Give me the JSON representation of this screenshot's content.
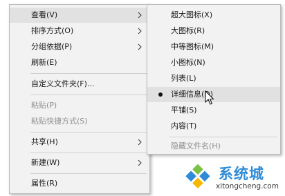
{
  "main_menu": {
    "items": [
      {
        "label": "查看(V)"
      },
      {
        "label": "排序方式(O)"
      },
      {
        "label": "分组依据(P)"
      },
      {
        "label": "刷新(E)"
      },
      {
        "label": "自定义文件夹(F)..."
      },
      {
        "label": "粘贴(P)"
      },
      {
        "label": "粘贴快捷方式(S)"
      },
      {
        "label": "共享(H)"
      },
      {
        "label": "新建(W)"
      },
      {
        "label": "属性(R)"
      }
    ]
  },
  "sub_menu": {
    "items": [
      {
        "label": "超大图标(X)"
      },
      {
        "label": "大图标(R)"
      },
      {
        "label": "中等图标(M)"
      },
      {
        "label": "小图标(N)"
      },
      {
        "label": "列表(L)"
      },
      {
        "label": "详细信息(D)",
        "checked": true
      },
      {
        "label": "平铺(S)"
      },
      {
        "label": "内容(T)"
      },
      {
        "label": "隐藏文件名(H)"
      }
    ]
  },
  "watermark": {
    "brand": "系统城",
    "url": "xitongcheng.com"
  },
  "colors": {
    "menu_bg": "#f2f2f2",
    "highlight": "#e1e1e1",
    "disabled_text": "#8e8e8e",
    "brand_blue": "#2f8bd6",
    "brand_green": "#7bc143"
  }
}
